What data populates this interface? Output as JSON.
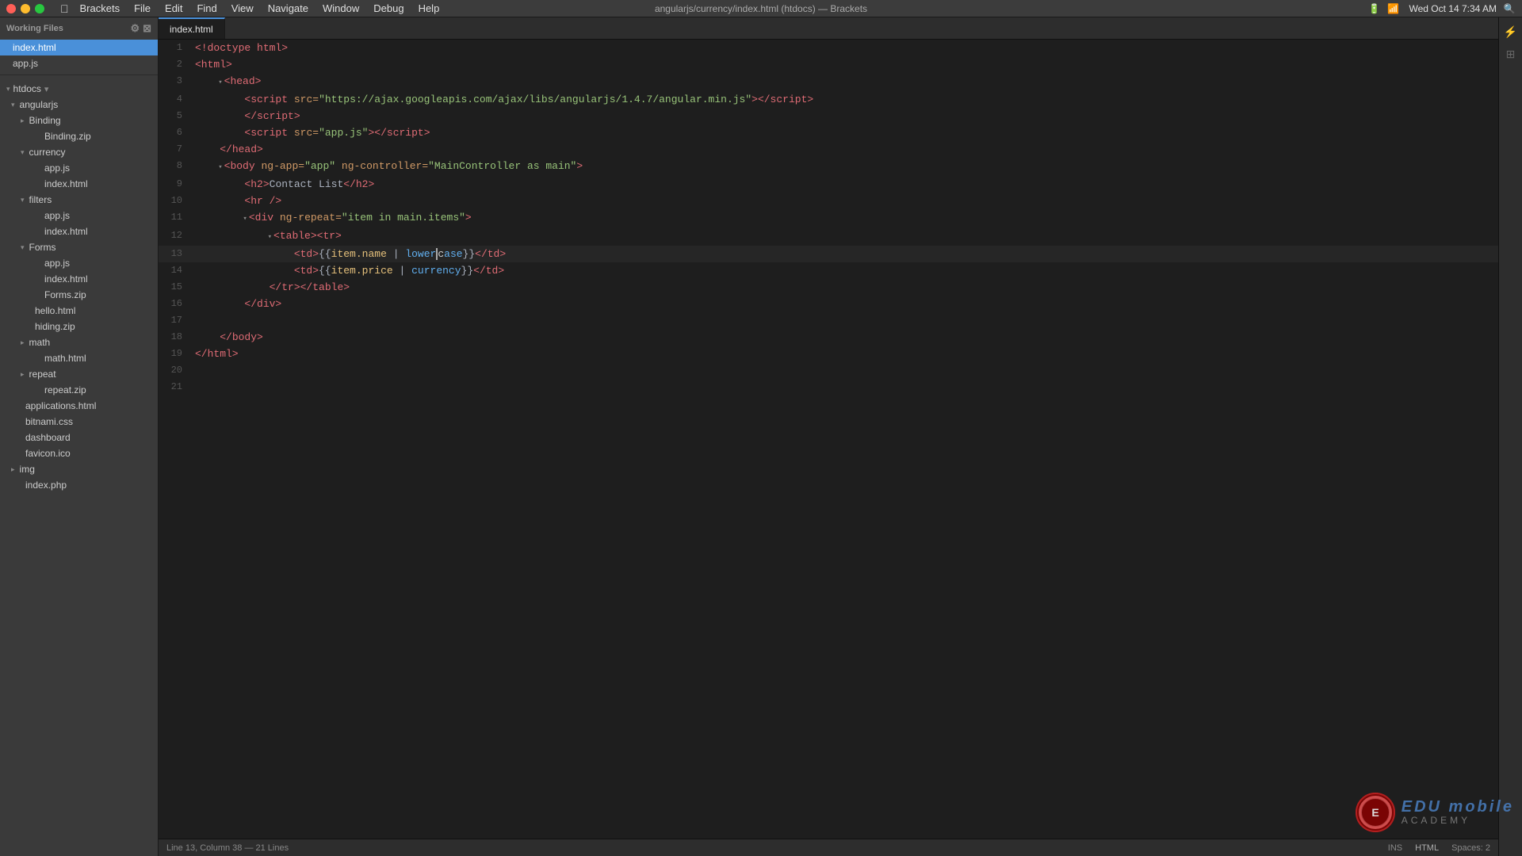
{
  "titlebar": {
    "title": "angularjs/currency/index.html (htdocs) — Brackets",
    "menu_items": [
      "Brackets",
      "File",
      "Edit",
      "Find",
      "View",
      "Navigate",
      "Window",
      "Debug",
      "Help"
    ],
    "time": "Wed Oct 14  7:34 AM"
  },
  "sidebar": {
    "working_files_label": "Working Files",
    "working_files": [
      {
        "name": "index.html",
        "active": true
      },
      {
        "name": "app.js",
        "active": false
      }
    ],
    "htdocs_label": "htdocs",
    "tree": [
      {
        "label": "angularjs",
        "indent": 1,
        "open": true,
        "type": "folder"
      },
      {
        "label": "Binding",
        "indent": 2,
        "open": false,
        "type": "folder"
      },
      {
        "label": "Binding.zip",
        "indent": 3,
        "type": "file"
      },
      {
        "label": "currency",
        "indent": 2,
        "open": true,
        "type": "folder"
      },
      {
        "label": "app.js",
        "indent": 3,
        "type": "file"
      },
      {
        "label": "index.html",
        "indent": 3,
        "type": "file"
      },
      {
        "label": "filters",
        "indent": 2,
        "open": true,
        "type": "folder"
      },
      {
        "label": "app.js",
        "indent": 3,
        "type": "file"
      },
      {
        "label": "index.html",
        "indent": 3,
        "type": "file"
      },
      {
        "label": "Forms",
        "indent": 2,
        "open": true,
        "type": "folder"
      },
      {
        "label": "app.js",
        "indent": 3,
        "type": "file"
      },
      {
        "label": "index.html",
        "indent": 3,
        "type": "file"
      },
      {
        "label": "Forms.zip",
        "indent": 3,
        "type": "file"
      },
      {
        "label": "hello.html",
        "indent": 2,
        "type": "file"
      },
      {
        "label": "hiding.zip",
        "indent": 2,
        "type": "file"
      },
      {
        "label": "math",
        "indent": 2,
        "open": false,
        "type": "folder"
      },
      {
        "label": "math.html",
        "indent": 3,
        "type": "file"
      },
      {
        "label": "repeat",
        "indent": 2,
        "open": false,
        "type": "folder"
      },
      {
        "label": "repeat.zip",
        "indent": 3,
        "type": "file"
      },
      {
        "label": "applications.html",
        "indent": 1,
        "type": "file"
      },
      {
        "label": "bitnami.css",
        "indent": 1,
        "type": "file"
      },
      {
        "label": "dashboard",
        "indent": 1,
        "type": "file"
      },
      {
        "label": "favicon.ico",
        "indent": 1,
        "type": "file"
      },
      {
        "label": "img",
        "indent": 1,
        "type": "folder"
      },
      {
        "label": "index.php",
        "indent": 1,
        "type": "file"
      }
    ]
  },
  "editor": {
    "tab_label": "index.html",
    "lines": [
      {
        "num": 1,
        "content": "<!doctype html>"
      },
      {
        "num": 2,
        "content": "<html>"
      },
      {
        "num": 3,
        "content": "    <head>",
        "foldable": true
      },
      {
        "num": 4,
        "content": "        <script src=\"https://ajax.googleapis.com/ajax/libs/angularjs/1.4.7/angular.min.js\"><\\/script>"
      },
      {
        "num": 5,
        "content": "        <\\/script>"
      },
      {
        "num": 6,
        "content": "        <script src=\"app.js\"><\\/script>"
      },
      {
        "num": 7,
        "content": "    <\\/head>"
      },
      {
        "num": 8,
        "content": "    <body ng-app=\"app\" ng-controller=\"MainController as main\">",
        "foldable": true
      },
      {
        "num": 9,
        "content": "        <h2>Contact List<\\/h2>"
      },
      {
        "num": 10,
        "content": "        <hr />"
      },
      {
        "num": 11,
        "content": "        <div ng-repeat=\"item in main.items\">",
        "foldable": true
      },
      {
        "num": 12,
        "content": "            <table><tr>",
        "foldable": true
      },
      {
        "num": 13,
        "content": "                <td>{{item.name | lowercase}}<\\/td>"
      },
      {
        "num": 14,
        "content": "                <td>{{item.price | currency}}<\\/td>"
      },
      {
        "num": 15,
        "content": "            <\\/tr><\\/table>"
      },
      {
        "num": 16,
        "content": "        <\\/div>"
      },
      {
        "num": 17,
        "content": ""
      },
      {
        "num": 18,
        "content": "    <\\/body>"
      },
      {
        "num": 19,
        "content": "<\\/html>"
      },
      {
        "num": 20,
        "content": ""
      },
      {
        "num": 21,
        "content": ""
      }
    ]
  },
  "statusbar": {
    "cursor_info": "Line 13, Column 38 — 21 Lines",
    "ins_label": "INS",
    "lang_label": "HTML",
    "spaces_label": "Spaces: 2"
  },
  "watermark": {
    "edu_label": "EDU mobile",
    "academy_label": "ACADEMY"
  }
}
